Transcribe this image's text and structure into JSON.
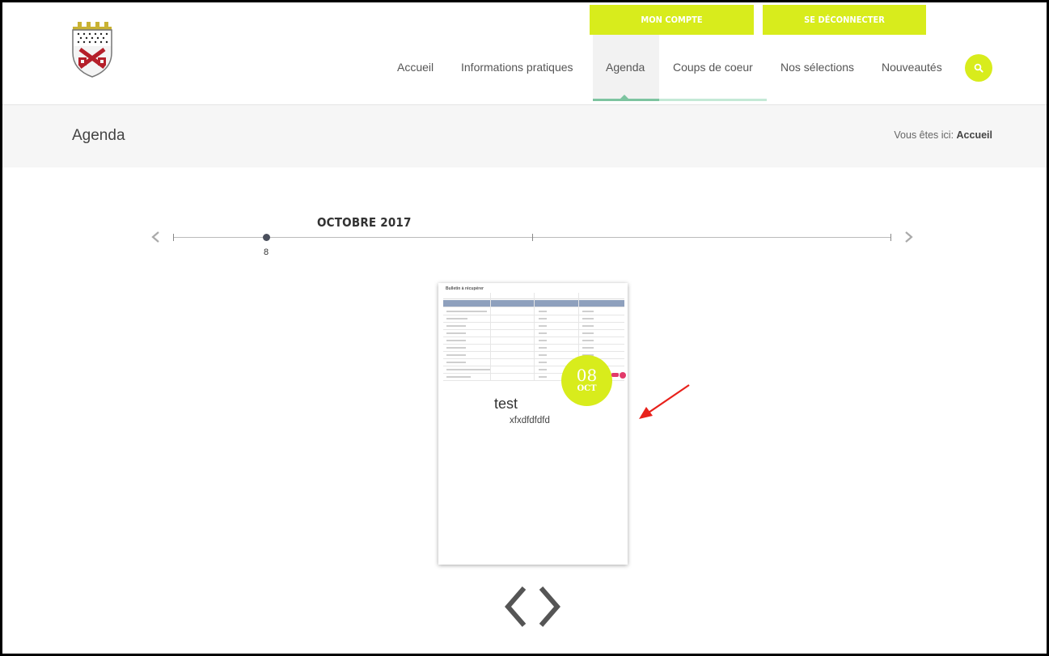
{
  "account": {
    "my_account": "MON COMPTE",
    "logout": "SE DÉCONNECTER"
  },
  "nav": {
    "items": [
      {
        "label": "Accueil",
        "active": false
      },
      {
        "label": "Informations pratiques",
        "active": false
      },
      {
        "label": "Agenda",
        "active": true
      },
      {
        "label": "Coups de coeur",
        "active": false
      },
      {
        "label": "Nos sélections",
        "active": false
      },
      {
        "label": "Nouveautés",
        "active": false
      }
    ],
    "search_icon": "search-icon"
  },
  "title_bar": {
    "title": "Agenda",
    "breadcrumb_prefix": "Vous êtes ici:",
    "breadcrumb_link": "Accueil"
  },
  "timeline": {
    "month": "OCTOBRE 2017",
    "event_day": "8",
    "prev_icon": "chevron-left-icon",
    "next_icon": "chevron-right-icon"
  },
  "event": {
    "day": "08",
    "month": "OCT",
    "title": "test",
    "description": "xfxdfdfdfd"
  },
  "thumbnail": {
    "title": "Bulletin à récupérer"
  },
  "carousel": {
    "prev_icon": "chevron-left-icon",
    "next_icon": "chevron-right-icon"
  },
  "colors": {
    "accent": "#d8ec1c",
    "nav_active": "#7dc4a0",
    "badge_pink": "#e23a6a",
    "annotation_red": "#e8211b"
  }
}
